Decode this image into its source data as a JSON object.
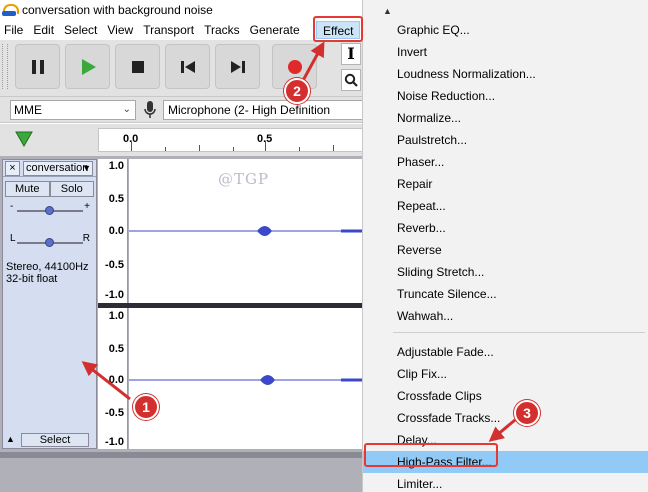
{
  "window": {
    "title": "conversation with background noise",
    "app_icon": "audacity-icon"
  },
  "menubar": {
    "items": [
      "File",
      "Edit",
      "Select",
      "View",
      "Transport",
      "Tracks",
      "Generate"
    ],
    "active": "Effect"
  },
  "toolbar": {
    "buttons": [
      "pause-icon",
      "play-icon",
      "stop-icon",
      "skip-start-icon",
      "skip-end-icon",
      "record-icon"
    ],
    "tool_select_glyph": "I",
    "colors": {
      "play": "#3aa83a",
      "record": "#e02a2a",
      "transport": "#222222"
    }
  },
  "devicebar": {
    "host": "MME",
    "input_device": "Microphone (2- High Definition"
  },
  "timeline": {
    "labels": [
      "0.0",
      "0.5"
    ]
  },
  "watermark": "@TGP",
  "track": {
    "name": "conversation",
    "close_glyph": "×",
    "mute_label": "Mute",
    "solo_label": "Solo",
    "gain_minus": "-",
    "gain_plus": "+",
    "pan_left": "L",
    "pan_right": "R",
    "gain_level": 0.5,
    "pan_level": 0.5,
    "info_line1": "Stereo, 44100Hz",
    "info_line2": "32-bit float",
    "select_label": "Select",
    "collapse_glyph": "▲"
  },
  "channel_ruler": [
    "1.0",
    "0.5",
    "0.0",
    "-0.5",
    "-1.0"
  ],
  "effect_menu": {
    "group1": [
      "Graphic EQ...",
      "Invert",
      "Loudness Normalization...",
      "Noise Reduction...",
      "Normalize...",
      "Paulstretch...",
      "Phaser...",
      "Repair",
      "Repeat...",
      "Reverb...",
      "Reverse",
      "Sliding Stretch...",
      "Truncate Silence...",
      "Wahwah..."
    ],
    "group2": [
      "Adjustable Fade...",
      "Clip Fix...",
      "Crossfade Clips",
      "Crossfade Tracks...",
      "Delay...",
      "High-Pass Filter...",
      "Limiter..."
    ],
    "highlighted": "High-Pass Filter...",
    "scroll_up_glyph": "▲"
  },
  "annotations": [
    "1",
    "2",
    "3"
  ],
  "colors": {
    "annotation": "#d32f2f",
    "highlight": "#91c9f7",
    "waveform": "#3b48c9"
  }
}
